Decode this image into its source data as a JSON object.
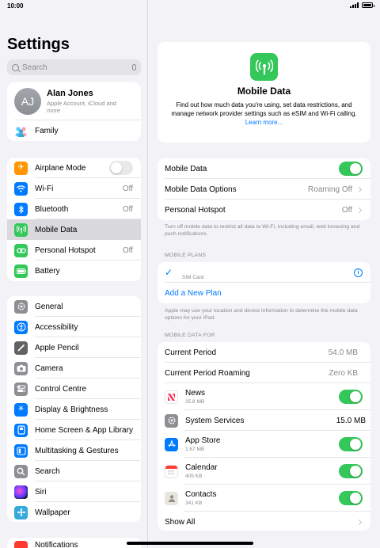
{
  "status": {
    "time": "10:00"
  },
  "sidebar": {
    "title": "Settings",
    "search_placeholder": "Search",
    "profile": {
      "initials": "AJ",
      "name": "Alan Jones",
      "subtitle": "Apple Account, iCloud and more"
    },
    "family_label": "Family",
    "group1": [
      {
        "label": "Airplane Mode",
        "icon": "airplane-icon",
        "color": "#ff9500",
        "control": "toggle-off"
      },
      {
        "label": "Wi-Fi",
        "icon": "wifi-icon",
        "color": "#007aff",
        "value": "Off"
      },
      {
        "label": "Bluetooth",
        "icon": "bluetooth-icon",
        "color": "#007aff",
        "value": "Off"
      },
      {
        "label": "Mobile Data",
        "icon": "antenna-icon",
        "color": "#34c759",
        "selected": true
      },
      {
        "label": "Personal Hotspot",
        "icon": "link-icon",
        "color": "#34c759",
        "value": "Off"
      },
      {
        "label": "Battery",
        "icon": "battery-icon",
        "color": "#34c759"
      }
    ],
    "group2": [
      {
        "label": "General",
        "icon": "gear-icon",
        "color": "#8e8e93"
      },
      {
        "label": "Accessibility",
        "icon": "accessibility-icon",
        "color": "#007aff"
      },
      {
        "label": "Apple Pencil",
        "icon": "pencil-icon",
        "color": "#636366"
      },
      {
        "label": "Camera",
        "icon": "camera-icon",
        "color": "#8e8e93"
      },
      {
        "label": "Control Centre",
        "icon": "switches-icon",
        "color": "#8e8e93"
      },
      {
        "label": "Display & Brightness",
        "icon": "sun-icon",
        "color": "#007aff"
      },
      {
        "label": "Home Screen & App Library",
        "icon": "home-screen-icon",
        "color": "#007aff"
      },
      {
        "label": "Multitasking & Gestures",
        "icon": "multitasking-icon",
        "color": "#007aff"
      },
      {
        "label": "Search",
        "icon": "search-icon",
        "color": "#8e8e93"
      },
      {
        "label": "Siri",
        "icon": "siri-icon",
        "color": "#2c2c54"
      },
      {
        "label": "Wallpaper",
        "icon": "wallpaper-icon",
        "color": "#34aadc"
      }
    ],
    "group3_partial": {
      "label": "Notifications",
      "icon": "bell-icon",
      "color": "#ff3b30"
    }
  },
  "detail": {
    "header": {
      "title": "Mobile Data",
      "description": "Find out how much data you're using, set data restrictions, and manage network provider settings such as eSIM and Wi-Fi calling.",
      "link": "Learn more..."
    },
    "main_rows": [
      {
        "label": "Mobile Data",
        "control": "toggle-on"
      },
      {
        "label": "Mobile Data Options",
        "value": "Roaming Off",
        "chevron": true
      },
      {
        "label": "Personal Hotspot",
        "value": "Off",
        "chevron": true
      }
    ],
    "main_note": "Turn off mobile data to restrict all data to Wi-Fi, including email, web browsing and push notifications.",
    "plans_header": "MOBILE PLANS",
    "sim_label": "SIM Card",
    "add_plan": "Add a New Plan",
    "plans_note": "Apple may use your location and device information to determine the mobile data options for your iPad.",
    "data_for_header": "MOBILE DATA FOR",
    "usage_rows": [
      {
        "label": "Current Period",
        "value": "54.0 MB"
      },
      {
        "label": "Current Period Roaming",
        "value": "Zero KB"
      }
    ],
    "apps": [
      {
        "label": "News",
        "size": "35.8 MB",
        "icon": "news-icon",
        "color": "#ff2d55",
        "control": "toggle-on"
      },
      {
        "label": "System Services",
        "value": "15.0 MB",
        "icon": "gear-icon",
        "color": "#8e8e93",
        "control": "chevron"
      },
      {
        "label": "App Store",
        "size": "1.67 MB",
        "icon": "app-store-icon",
        "color": "#007aff",
        "control": "toggle-on"
      },
      {
        "label": "Calendar",
        "size": "405 KB",
        "icon": "calendar-icon",
        "color": "#ffffff",
        "control": "toggle-on"
      },
      {
        "label": "Contacts",
        "size": "341 KB",
        "icon": "contacts-icon",
        "color": "#d1cfc4",
        "control": "toggle-on"
      }
    ],
    "show_all": "Show All"
  }
}
